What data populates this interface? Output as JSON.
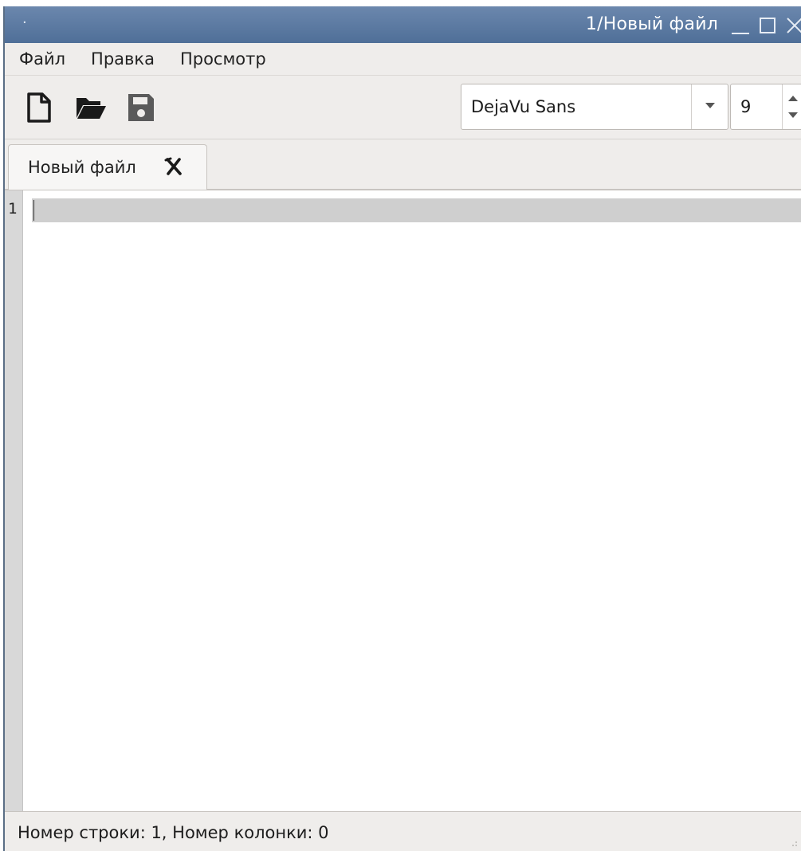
{
  "window": {
    "title_dot": "·",
    "title": "1/Новый файл"
  },
  "menu": {
    "items": [
      "Файл",
      "Правка",
      "Просмотр"
    ]
  },
  "toolbar": {
    "new_icon": "new-file-icon",
    "open_icon": "open-folder-icon",
    "save_icon": "save-icon",
    "font_family": "DejaVu Sans",
    "font_size": "9"
  },
  "tabs": [
    {
      "label": "Новый файл",
      "close_icon": "close-tab-icon"
    }
  ],
  "editor": {
    "line_numbers": [
      "1"
    ],
    "content": "",
    "colors": {
      "current_line": "#cfcfcf",
      "gutter": "#d8d8d8"
    }
  },
  "status": {
    "text": "Номер строки: 1, Номер колонки: 0"
  },
  "colors": {
    "titlebar": "#5b7aa3",
    "window_bg": "#efedeb"
  }
}
